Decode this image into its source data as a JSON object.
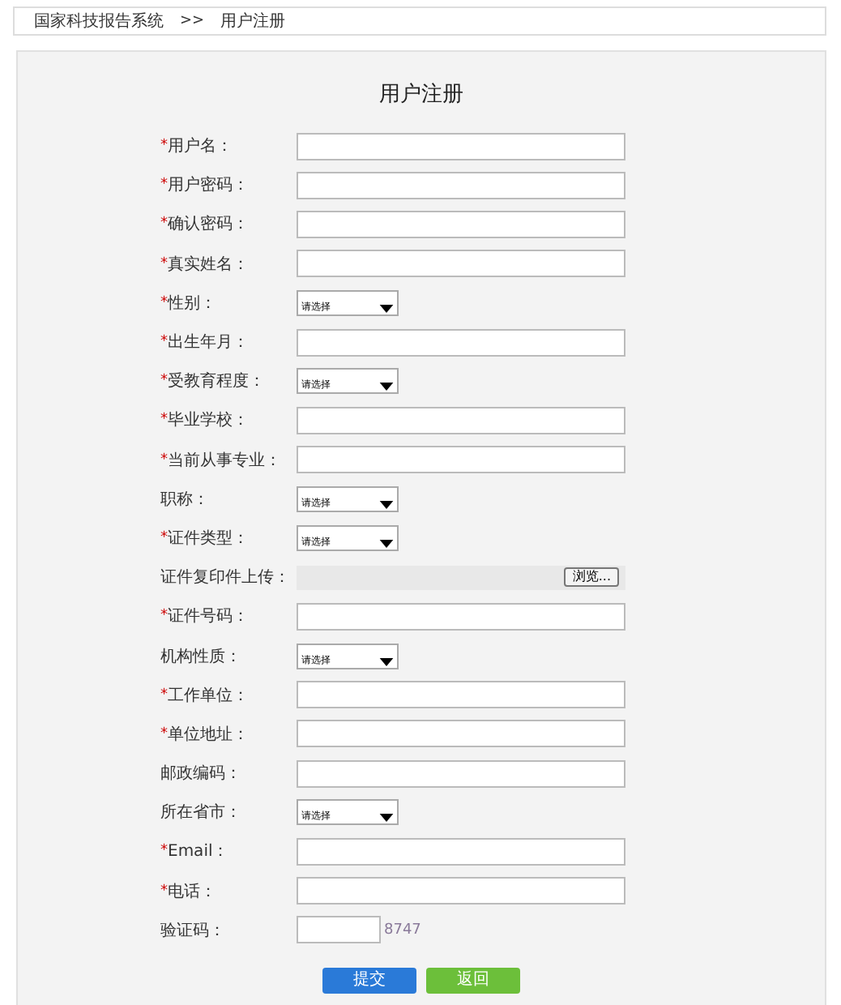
{
  "breadcrumb": {
    "items": [
      "国家科技报告系统",
      "用户注册"
    ],
    "separator": ">>"
  },
  "form": {
    "title": "用户注册",
    "rows": [
      {
        "kind": "text",
        "marker": "*",
        "label": "用户名："
      },
      {
        "kind": "text",
        "marker": "*",
        "label": "用户密码："
      },
      {
        "kind": "text",
        "marker": "*",
        "label": "确认密码："
      },
      {
        "kind": "text",
        "marker": "*",
        "label": "真实姓名："
      },
      {
        "kind": "select",
        "marker": "*",
        "label": "性别：",
        "placeholder": "请选择"
      },
      {
        "kind": "text",
        "marker": "*",
        "label": "出生年月："
      },
      {
        "kind": "select",
        "marker": "*",
        "label": "受教育程度：",
        "placeholder": "请选择"
      },
      {
        "kind": "text",
        "marker": "*",
        "label": "毕业学校："
      },
      {
        "kind": "text",
        "marker": "*",
        "label": "当前从事专业："
      },
      {
        "kind": "select",
        "label": "职称：",
        "placeholder": "请选择"
      },
      {
        "kind": "select",
        "marker": "*",
        "label": "证件类型：",
        "placeholder": "请选择"
      },
      {
        "kind": "file",
        "label": "证件复印件上传：",
        "button": "浏览..."
      },
      {
        "kind": "text",
        "marker": "*",
        "label": "证件号码："
      },
      {
        "kind": "select",
        "label": "机构性质：",
        "placeholder": "请选择"
      },
      {
        "kind": "text",
        "marker": "*",
        "label": "工作单位："
      },
      {
        "kind": "text",
        "marker": "*",
        "label": "单位地址："
      },
      {
        "kind": "text",
        "label": "邮政编码："
      },
      {
        "kind": "select",
        "label": "所在省市：",
        "placeholder": "请选择"
      },
      {
        "kind": "text",
        "marker": "*",
        "label": "Email："
      },
      {
        "kind": "text",
        "marker": "*",
        "label": "电话："
      },
      {
        "kind": "captcha",
        "label": "验证码：",
        "code": "8747"
      }
    ],
    "buttons": [
      {
        "kind": "primary",
        "label": "提交"
      },
      {
        "kind": "secondary",
        "label": "返回"
      }
    ]
  }
}
